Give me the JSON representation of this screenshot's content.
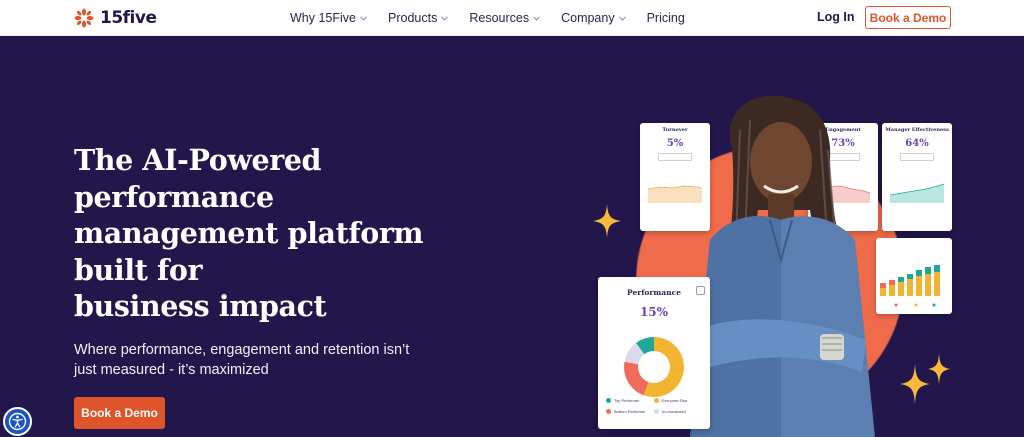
{
  "nav": {
    "logo_text": "15five",
    "menu": [
      {
        "label": "Why 15Five",
        "has_dropdown": true
      },
      {
        "label": "Products",
        "has_dropdown": true
      },
      {
        "label": "Resources",
        "has_dropdown": true
      },
      {
        "label": "Company",
        "has_dropdown": true
      },
      {
        "label": "Pricing",
        "has_dropdown": false
      }
    ],
    "login_label": "Log In",
    "cta_label": "Book a Demo"
  },
  "hero": {
    "title_lines": [
      "The AI-Powered",
      "performance",
      "management platform",
      "built for",
      "business impact"
    ],
    "subtitle": "Where performance, engagement and retention isn’t just measured - it’s maximized",
    "cta_label": "Book a Demo"
  },
  "illustration": {
    "cards": [
      {
        "title": "Turnover",
        "value": "5%"
      },
      {
        "title": "Engagement",
        "value": "73%"
      },
      {
        "title": "Manager Effectiveness",
        "value": "64%"
      }
    ],
    "performance_card": {
      "title": "Performance",
      "value": "15%",
      "legend": [
        "Top Performer",
        "Everyone Else",
        "Bottom Performer",
        "Un-measured"
      ]
    }
  },
  "colors": {
    "brand_orange": "#e0542b",
    "hero_bg": "#22164b",
    "accent_purple": "#6b3fc4",
    "sparkle": "#f6b93b",
    "teal": "#1fa89a",
    "yellow": "#f2b431",
    "coral": "#ef6b5a",
    "light_grey": "#dcdaea"
  },
  "icons": [
    "logo-burst-icon",
    "chevron-down-icon",
    "accessibility-icon",
    "sparkle-icon",
    "settings-icon"
  ]
}
